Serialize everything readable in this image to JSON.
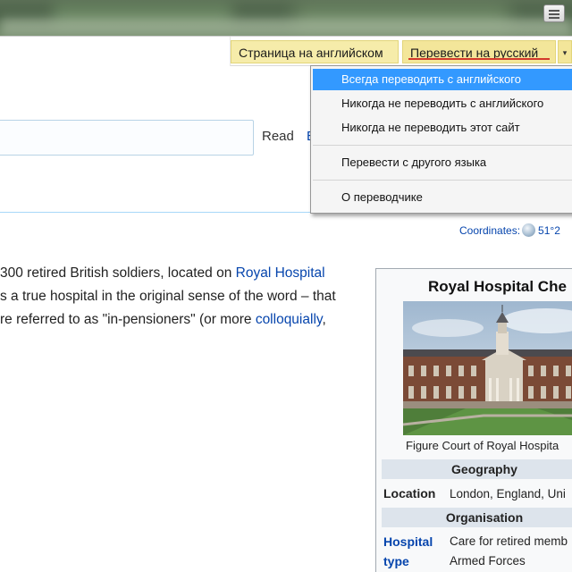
{
  "translate_bar": {
    "show_original_label": "Страница на английском",
    "translate_label": "Перевести на русский",
    "options_arrow": "▾"
  },
  "translate_menu": {
    "items": [
      {
        "label": "Всегда переводить с английского",
        "active": true
      },
      {
        "label": "Никогда не переводить с английского",
        "active": false
      },
      {
        "label": "Никогда не переводить этот сайт",
        "active": false
      },
      {
        "label": "Перевести с другого языка",
        "active": false,
        "submenu_arrow": "›"
      },
      {
        "label": "О переводчике",
        "active": false
      }
    ]
  },
  "page_tabs": {
    "read": "Read",
    "edit_partial": "E"
  },
  "coordinates": {
    "label": "Coordinates:",
    "value": "51°2"
  },
  "article": {
    "line1": {
      "text": "300 retired British soldiers, located on ",
      "link": "Royal Hospital"
    },
    "line2": {
      "text": "s a true hospital in the original sense of the word – that"
    },
    "line3": {
      "text": "re referred to as \"in-pensioners\" (or more ",
      "link": "colloquially",
      "tail": ","
    }
  },
  "infobox": {
    "title": "Royal Hospital Che",
    "caption": "Figure Court of Royal Hospita",
    "sections": {
      "geography": "Geography",
      "organisation": "Organisation"
    },
    "location": {
      "label": "Location",
      "value": "London, England, Uni"
    },
    "hospital_type": {
      "label_line1": "Hospital",
      "label_line2": "type",
      "value_line1": "Care for retired memb",
      "value_line2": "Armed Forces"
    }
  },
  "colors": {
    "translate_bar_bg": "#f6ecaa",
    "menu_highlight": "#3399ff",
    "link": "#0645ad",
    "underline": "#d33a2c"
  }
}
